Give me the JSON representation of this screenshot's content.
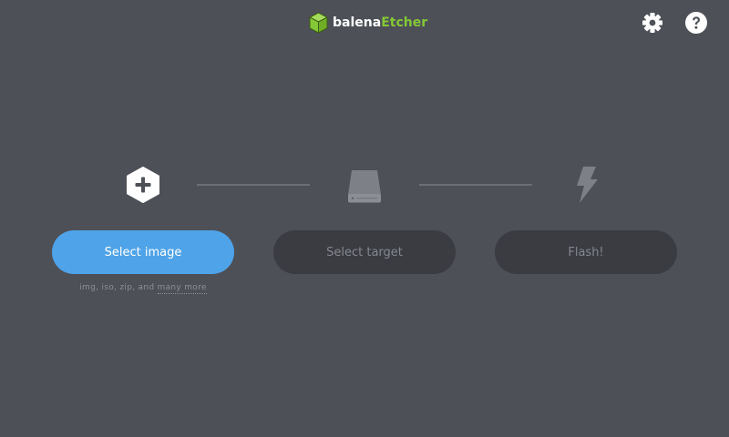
{
  "header": {
    "logo": {
      "brand_text": "balena",
      "product_text": "Etcher",
      "brand_color": "#ffffff",
      "product_color": "#85c837",
      "icon": "balena-cube-icon"
    },
    "settings_icon": "gear-icon",
    "help_icon": "question-mark-icon"
  },
  "steps": {
    "image": {
      "icon": "plus-hexagon-icon",
      "button_label": "Select image",
      "formats_prefix": "img, iso, zip, and",
      "formats_more": "many more"
    },
    "target": {
      "icon": "drive-icon",
      "button_label": "Select target"
    },
    "flash": {
      "icon": "lightning-bolt-icon",
      "button_label": "Flash!"
    }
  },
  "colors": {
    "background": "#4d5057",
    "accent": "#4fa3e9",
    "disabled_button": "#3a3c41",
    "brand_green": "#85c837"
  }
}
